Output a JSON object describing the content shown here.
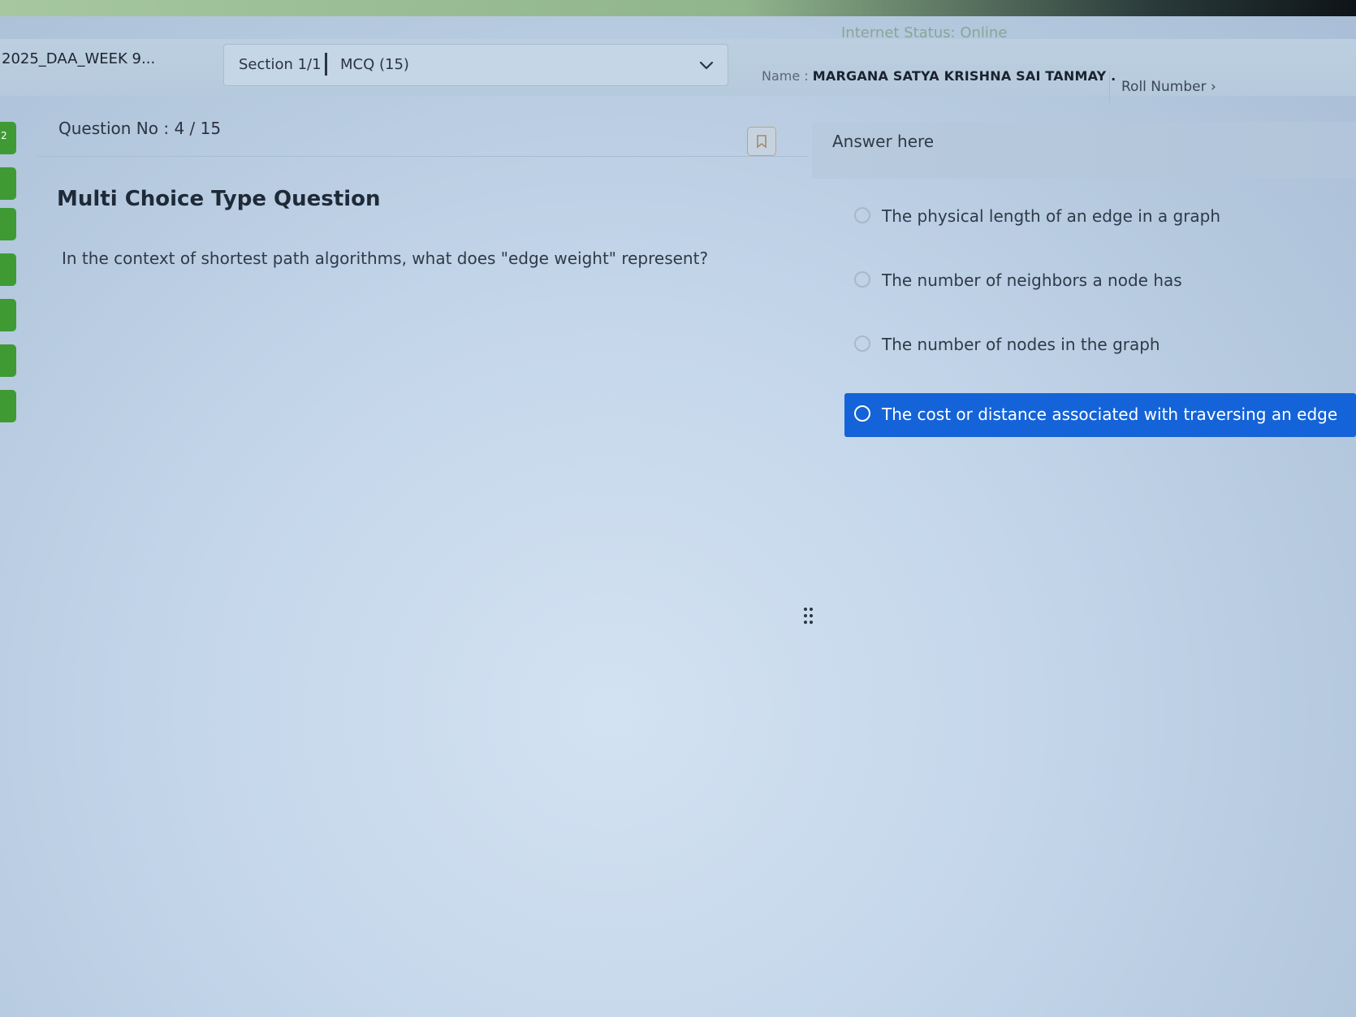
{
  "header": {
    "internet_status": "Internet Status: Online",
    "test_title": "2025_DAA_WEEK 9...",
    "section_label": "Section 1/1",
    "section_type": "MCQ (15)",
    "name_label": "Name :",
    "name_value": "MARGANA SATYA KRISHNA SAI TANMAY .",
    "roll_label": "Roll Number"
  },
  "sidebar": {
    "tabs": [
      {
        "label": "2"
      },
      {
        "label": ""
      },
      {
        "label": ""
      },
      {
        "label": ""
      },
      {
        "label": ""
      },
      {
        "label": ""
      },
      {
        "label": ""
      }
    ]
  },
  "question": {
    "number_label": "Question No : 4 / 15",
    "type_label": "Multi Choice Type Question",
    "text": "In the context of shortest path algorithms, what does \"edge weight\" represent?"
  },
  "answer": {
    "header": "Answer here",
    "options": [
      {
        "label": "The physical length of an edge in a graph",
        "selected": false
      },
      {
        "label": "The number of neighbors a node has",
        "selected": false
      },
      {
        "label": "The number of nodes in the graph",
        "selected": false
      },
      {
        "label": "The cost or distance associated with traversing an edge",
        "selected": true
      }
    ]
  },
  "colors": {
    "selected_option": "#1463d8",
    "side_tab": "#3f9a34"
  },
  "icons": [
    "chevron-down-icon",
    "bookmark-icon",
    "radio-icon",
    "drag-handle-icon",
    "chevron-right-icon"
  ]
}
